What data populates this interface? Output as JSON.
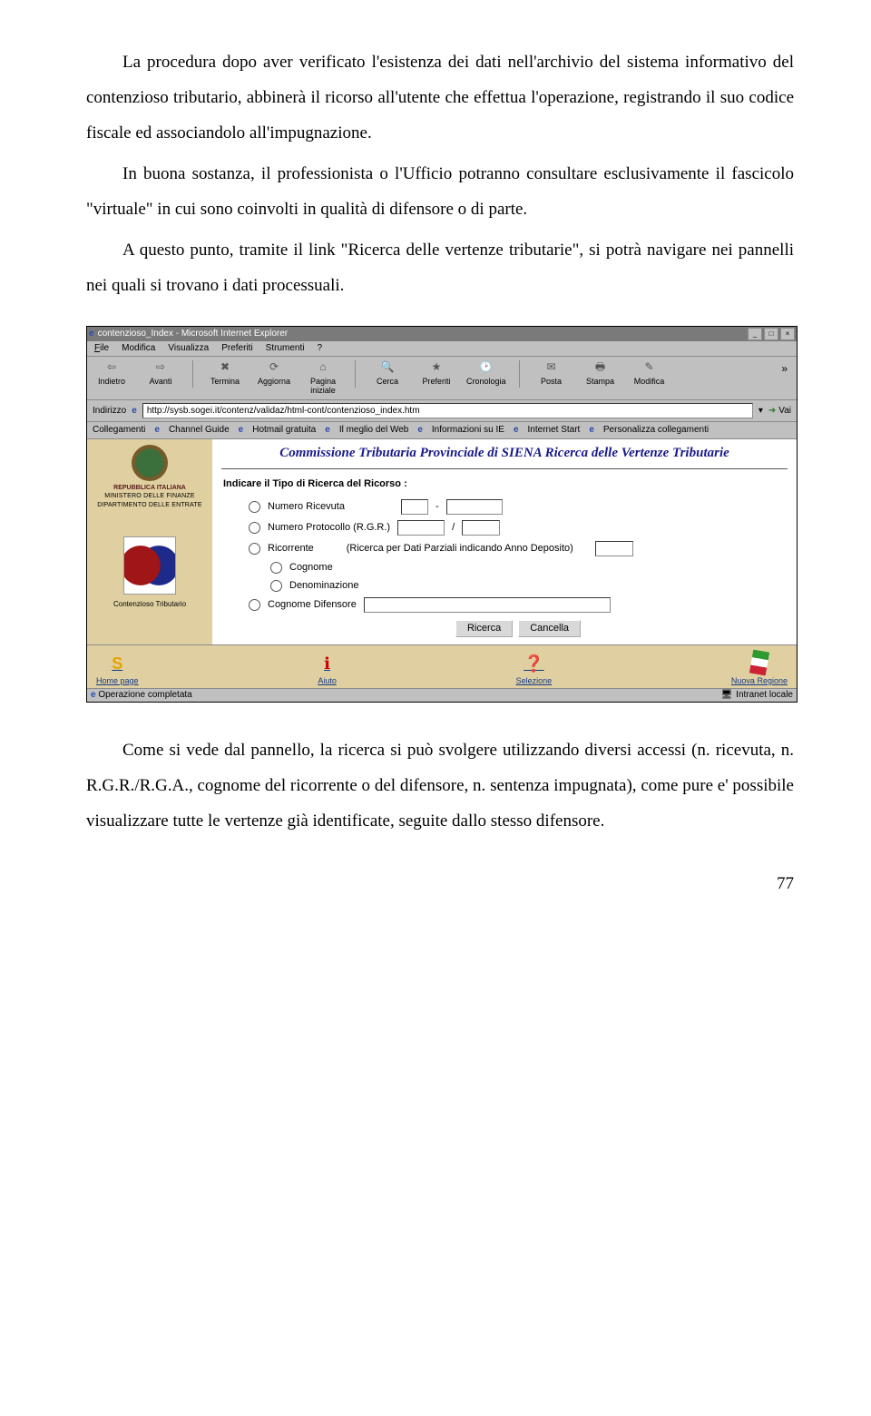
{
  "paragraphs": {
    "p1": "La procedura dopo aver verificato l'esistenza dei dati nell'archivio del sistema informativo del contenzioso tributario, abbinerà il ricorso all'utente che effettua l'operazione, registrando il suo codice fiscale ed associandolo all'impugnazione.",
    "p2": "In buona sostanza, il professionista o l'Ufficio potranno consultare esclusivamente il fascicolo \"virtuale\" in cui sono coinvolti in qualità di difensore o di parte.",
    "p3": "A questo punto, tramite il link \"Ricerca delle vertenze tributarie\", si potrà navigare nei pannelli nei quali si trovano i dati processuali.",
    "p4": "Come si vede dal pannello, la ricerca si può svolgere utilizzando diversi accessi (n. ricevuta, n. R.G.R./R.G.A., cognome del ricorrente o del difensore, n. sentenza impugnata), come pure e' possibile visualizzare tutte le vertenze già identificate, seguite dallo stesso difensore.",
    "pagenum": "77"
  },
  "browser": {
    "title": "contenzioso_Index - Microsoft Internet Explorer",
    "menu": [
      "File",
      "Modifica",
      "Visualizza",
      "Preferiti",
      "Strumenti",
      "?"
    ],
    "toolbar": {
      "back": "Indietro",
      "forward": "Avanti",
      "stop": "Termina",
      "refresh": "Aggiorna",
      "home1": "Pagina",
      "home2": "iniziale",
      "search": "Cerca",
      "fav": "Preferiti",
      "hist": "Cronologia",
      "mail": "Posta",
      "print": "Stampa",
      "edit": "Modifica"
    },
    "addr_label": "Indirizzo",
    "addr_url": "http://sysb.sogei.it/contenz/validaz/html-cont/contenzioso_index.htm",
    "go": "Vai",
    "links_label": "Collegamenti",
    "links": [
      "Channel Guide",
      "Hotmail gratuita",
      "Il meglio del Web",
      "Informazioni su IE",
      "Internet Start",
      "Personalizza collegamenti"
    ],
    "status_left": "Operazione completata",
    "status_right": "Intranet locale"
  },
  "sidebar": {
    "line1": "MINISTERO DELLE FINANZE",
    "line2": "DIPARTIMENTO DELLE ENTRATE",
    "caption": "Contenzioso Tributario"
  },
  "main": {
    "title": "Commissione Tributaria Provinciale di SIENA Ricerca delle Vertenze Tributarie",
    "prompt": "Indicare il Tipo di Ricerca del Ricorso :",
    "opt_ricevuta": "Numero Ricevuta",
    "opt_protocollo": "Numero Protocollo (R.G.R.)",
    "opt_ricorrente": "Ricorrente",
    "opt_ricorrente_note": "(Ricerca per Dati Parziali indicando Anno Deposito)",
    "opt_cognome": "Cognome",
    "opt_denom": "Denominazione",
    "opt_cogdif": "Cognome Difensore",
    "btn_search": "Ricerca",
    "btn_clear": "Cancella"
  },
  "bottomlinks": {
    "home": "Home page",
    "help": "Aiuto",
    "sel": "Selezione",
    "region": "Nuova Regione"
  }
}
